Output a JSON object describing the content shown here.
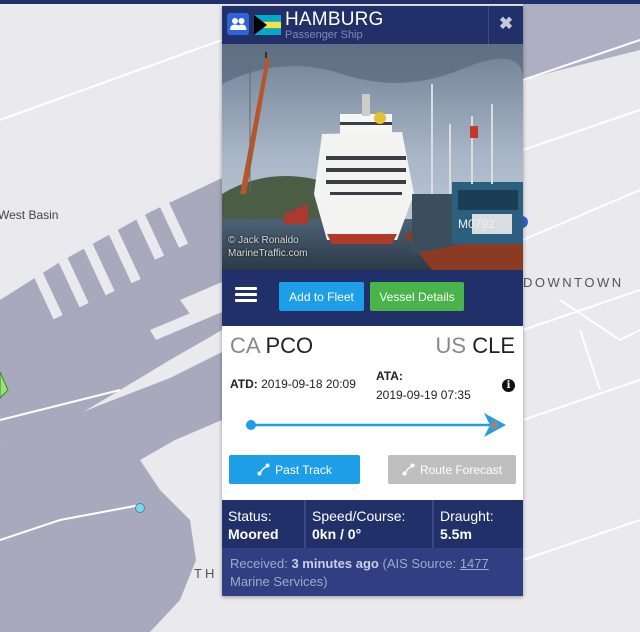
{
  "map": {
    "labels": {
      "west_basin": "West Basin",
      "downtown": "DOWNTOWN",
      "th": "TH"
    },
    "colors": {
      "land": "#e9e9ee",
      "water": "#a9a9be",
      "road": "#ffffff",
      "marker": "#7fd6e8"
    }
  },
  "vessel": {
    "name": "HAMBURG",
    "type": "Passenger Ship",
    "flag_icon": "bahamas-flag-icon",
    "fleet_icon": "users-icon",
    "close_icon": "close-icon"
  },
  "photo": {
    "credit_line1": "© Jack Ronaldo",
    "credit_line2": "MarineTraffic.com",
    "ship_text": "M0792"
  },
  "actions": {
    "menu_icon": "hamburger-menu-icon",
    "add_to_fleet": "Add to Fleet",
    "vessel_details": "Vessel Details"
  },
  "route": {
    "from_country": "CA",
    "from_port": "PCO",
    "to_country": "US",
    "to_port": "CLE",
    "atd_label": "ATD:",
    "atd_value": "2019-09-18 20:09",
    "ata_label": "ATA:",
    "ata_value": "2019-09-19 07:35",
    "info_icon": "info-icon",
    "progress": 1.0,
    "past_track": "Past Track",
    "route_forecast": "Route Forecast"
  },
  "stats": {
    "status_label": "Status:",
    "status_value": "Moored",
    "speed_label": "Speed/Course:",
    "speed_value": "0kn / 0°",
    "draught_label": "Draught:",
    "draught_value": "5.5m"
  },
  "footer": {
    "received_label": "Received:",
    "received_value": "3 minutes ago",
    "source_prefix": "(AIS Source:",
    "source_link": "1477",
    "source_suffix": "Marine Services)"
  },
  "colors": {
    "navy": "#22306a",
    "blue_button": "#1e9ee6",
    "green_button": "#49b44a",
    "grey_button": "#bfbfbf"
  }
}
